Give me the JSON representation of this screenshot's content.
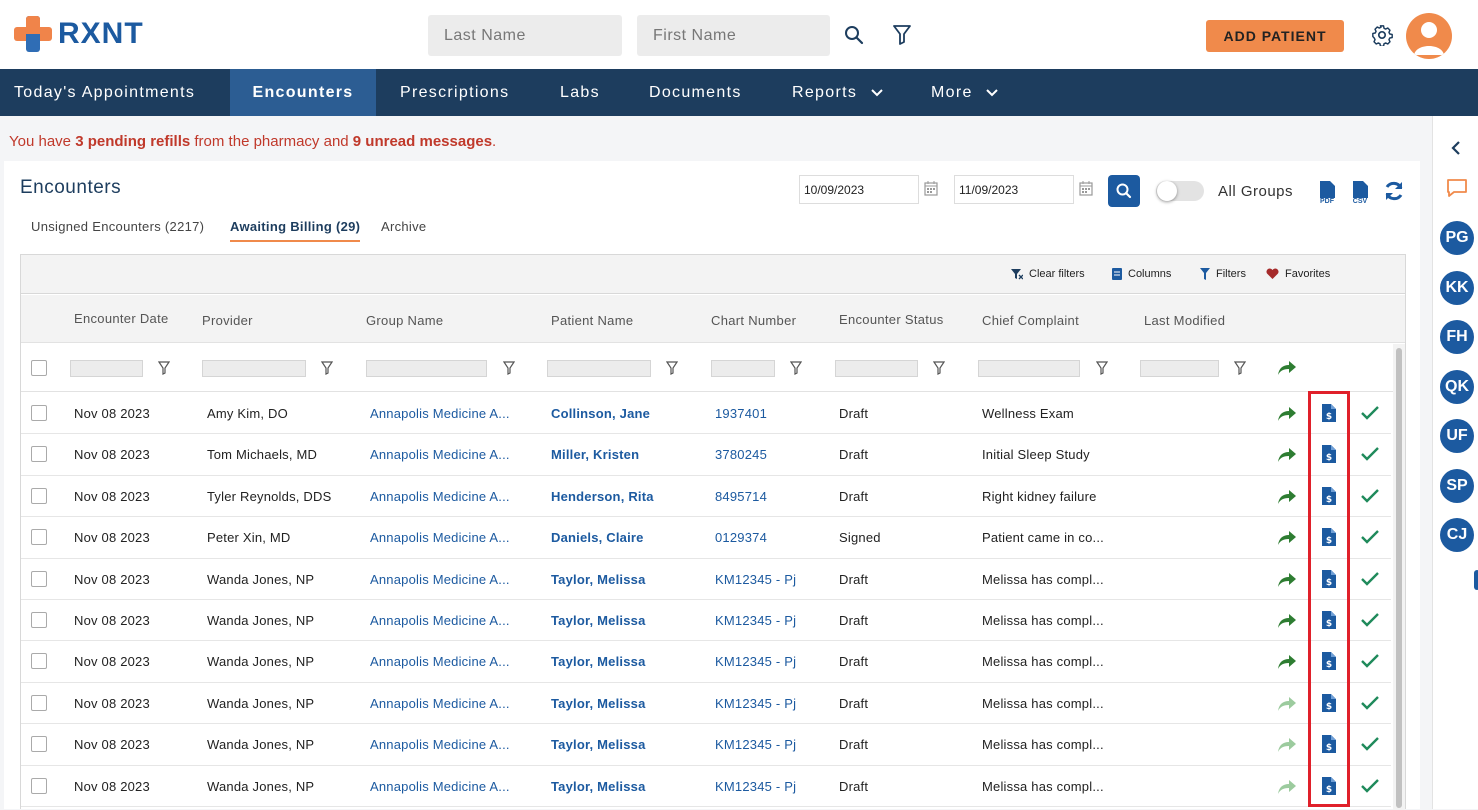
{
  "header": {
    "brand": "RXNT",
    "last_name_placeholder": "Last Name",
    "first_name_placeholder": "First Name",
    "add_patient_label": "ADD PATIENT"
  },
  "nav": {
    "items": [
      "Today's Appointments",
      "Encounters",
      "Prescriptions",
      "Labs",
      "Documents",
      "Reports",
      "More"
    ],
    "active": "Encounters"
  },
  "alert": {
    "prefix": "You have ",
    "refills": "3 pending refills",
    "middle": " from the pharmacy and ",
    "messages": "9 unread messages",
    "suffix": "."
  },
  "panel": {
    "title": "Encounters",
    "date_from": "10/09/2023",
    "date_to": "11/09/2023",
    "all_groups_label": "All Groups",
    "tabs": [
      "Unsigned Encounters (2217)",
      "Awaiting Billing (29)",
      "Archive"
    ],
    "active_tab": "Awaiting Billing (29)"
  },
  "toolbar": {
    "clear_filters": "Clear filters",
    "columns": "Columns",
    "filters": "Filters",
    "favorites": "Favorites"
  },
  "table": {
    "columns": [
      "Encounter Date",
      "Provider",
      "Group Name",
      "Patient Name",
      "Chart Number",
      "Encounter Status",
      "Chief Complaint",
      "Last Modified"
    ],
    "rows": [
      {
        "date": "Nov 08 2023",
        "provider": "Amy Kim, DO",
        "group": "Annapolis Medicine A...",
        "patient": "Collinson, Jane",
        "chart": "1937401",
        "status": "Draft",
        "complaint": "Wellness Exam",
        "arrow_active": true
      },
      {
        "date": "Nov 08 2023",
        "provider": "Tom Michaels, MD",
        "group": "Annapolis Medicine A...",
        "patient": "Miller, Kristen",
        "chart": "3780245",
        "status": "Draft",
        "complaint": "Initial Sleep Study",
        "arrow_active": true
      },
      {
        "date": "Nov 08 2023",
        "provider": "Tyler Reynolds, DDS",
        "group": "Annapolis Medicine A...",
        "patient": "Henderson, Rita",
        "chart": "8495714",
        "status": "Draft",
        "complaint": "Right kidney failure",
        "arrow_active": true
      },
      {
        "date": "Nov 08 2023",
        "provider": "Peter Xin, MD",
        "group": "Annapolis Medicine A...",
        "patient": "Daniels, Claire",
        "chart": "0129374",
        "status": "Signed",
        "complaint": "Patient came in co...",
        "arrow_active": true
      },
      {
        "date": "Nov 08 2023",
        "provider": "Wanda Jones, NP",
        "group": "Annapolis Medicine A...",
        "patient": "Taylor, Melissa",
        "chart": "KM12345 - Pj",
        "status": "Draft",
        "complaint": "Melissa has compl...",
        "arrow_active": true
      },
      {
        "date": "Nov 08 2023",
        "provider": "Wanda Jones, NP",
        "group": "Annapolis Medicine A...",
        "patient": "Taylor, Melissa",
        "chart": "KM12345 - Pj",
        "status": "Draft",
        "complaint": "Melissa has compl...",
        "arrow_active": true
      },
      {
        "date": "Nov 08 2023",
        "provider": "Wanda Jones, NP",
        "group": "Annapolis Medicine A...",
        "patient": "Taylor, Melissa",
        "chart": "KM12345 - Pj",
        "status": "Draft",
        "complaint": "Melissa has compl...",
        "arrow_active": true
      },
      {
        "date": "Nov 08 2023",
        "provider": "Wanda Jones, NP",
        "group": "Annapolis Medicine A...",
        "patient": "Taylor, Melissa",
        "chart": "KM12345 - Pj",
        "status": "Draft",
        "complaint": "Melissa has compl...",
        "arrow_active": false
      },
      {
        "date": "Nov 08 2023",
        "provider": "Wanda Jones, NP",
        "group": "Annapolis Medicine A...",
        "patient": "Taylor, Melissa",
        "chart": "KM12345 - Pj",
        "status": "Draft",
        "complaint": "Melissa has compl...",
        "arrow_active": false
      },
      {
        "date": "Nov 08 2023",
        "provider": "Wanda Jones, NP",
        "group": "Annapolis Medicine A...",
        "patient": "Taylor, Melissa",
        "chart": "KM12345 - Pj",
        "status": "Draft",
        "complaint": "Melissa has compl...",
        "arrow_active": false
      }
    ]
  },
  "sidebar": {
    "users": [
      "PG",
      "KK",
      "FH",
      "QK",
      "UF",
      "SP",
      "CJ"
    ]
  },
  "colors": {
    "nav_bg": "#1d3d5e",
    "nav_active": "#2c5d93",
    "accent": "#f08a4b",
    "link": "#1c5aa0",
    "alert": "#c0392b",
    "check": "#1f8a5b",
    "highlight_box": "#e0202a"
  }
}
